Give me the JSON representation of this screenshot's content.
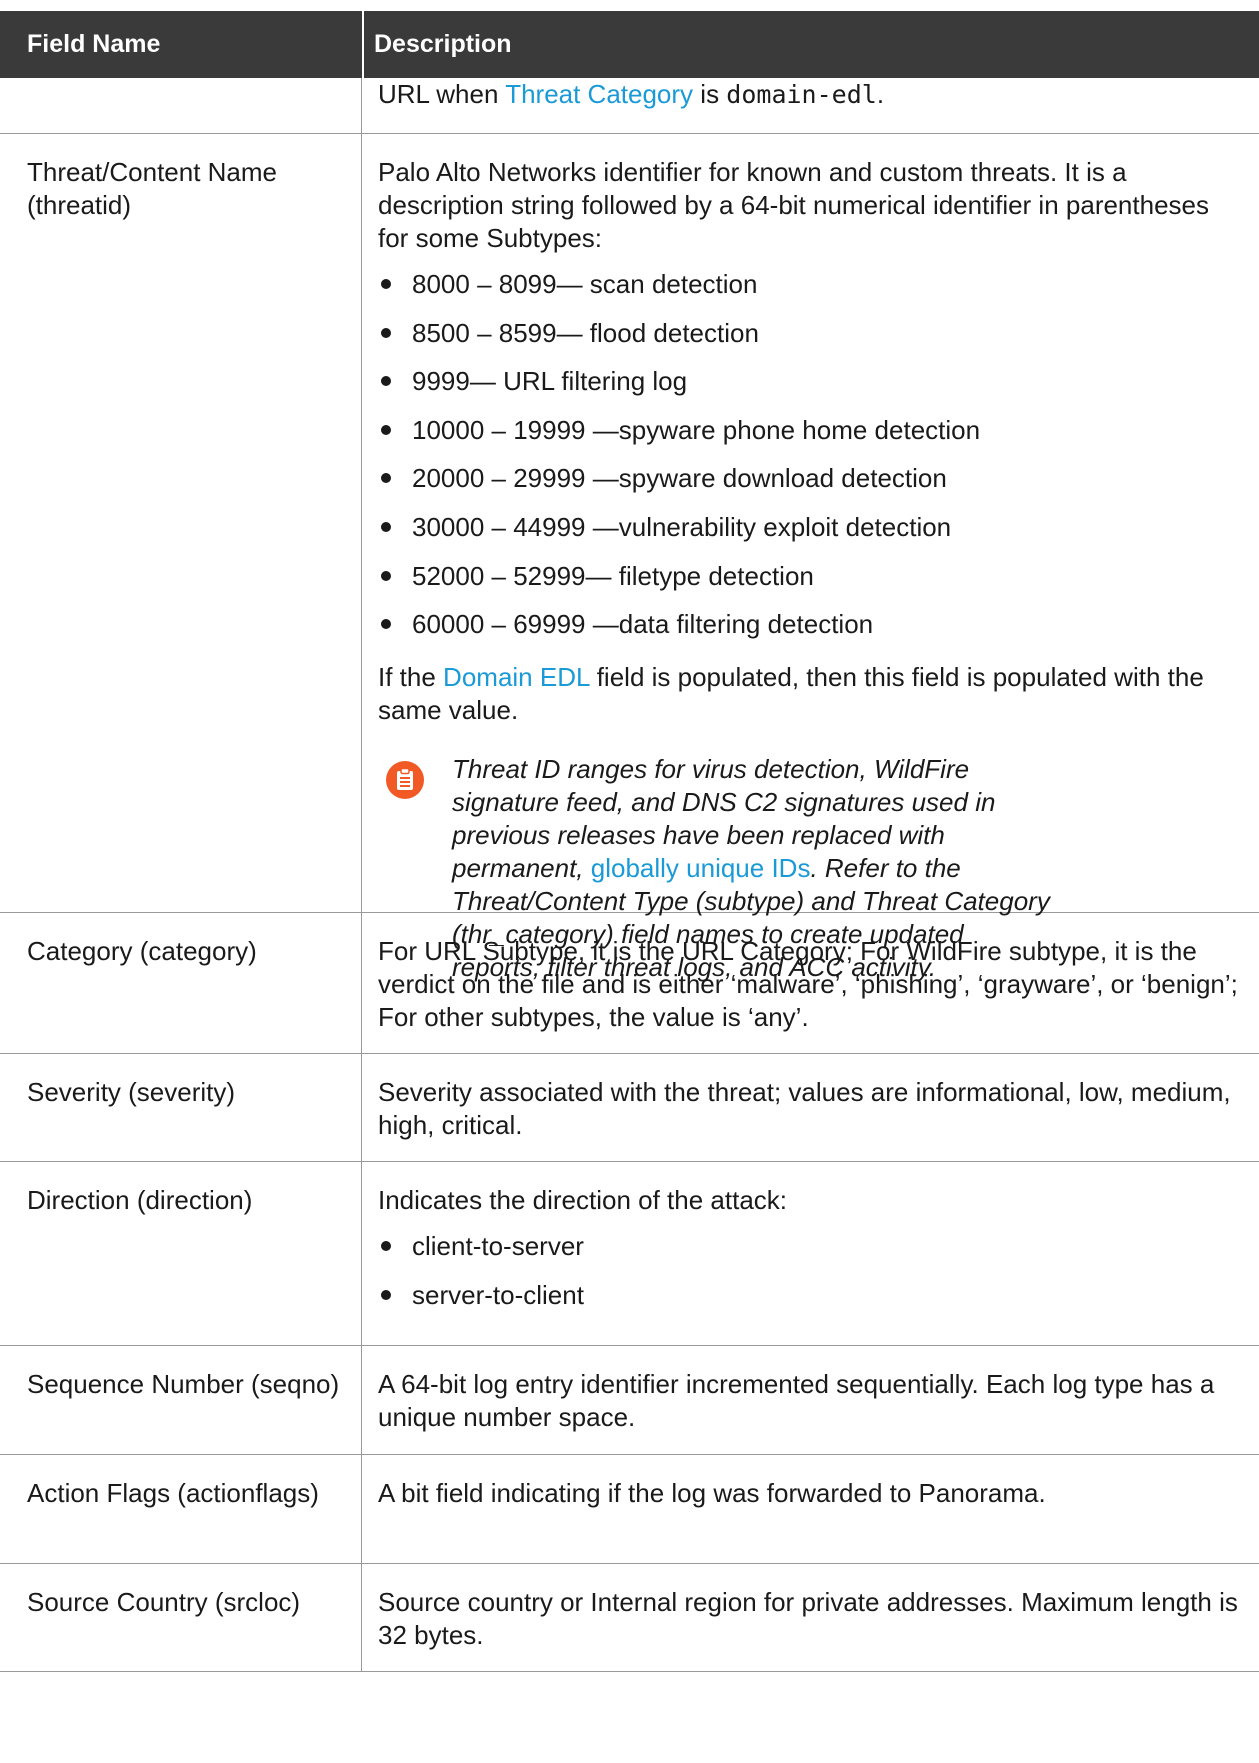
{
  "header": {
    "col_name": "Field Name",
    "col_desc": "Description"
  },
  "row0": {
    "text_a": "URL when ",
    "link": "Threat Category",
    "text_b": " is ",
    "mono": "domain-edl",
    "text_c": "."
  },
  "row1": {
    "name": "Threat/Content Name (threatid)",
    "intro": "Palo Alto Networks identifier for known and custom threats. It is a description string followed by a 64-bit numerical identifier in parentheses for some Subtypes:",
    "bullets": [
      "8000 – 8099— scan detection",
      "8500 – 8599— flood detection",
      "9999— URL filtering log",
      "10000 – 19999 —spyware phone home detection",
      "20000 – 29999 —spyware download detection",
      "30000 – 44999 —vulnerability exploit detection",
      "52000 – 52999— filetype detection",
      "60000 – 69999 —data filtering detection"
    ],
    "edl_a": "If the ",
    "edl_link": "Domain EDL",
    "edl_b": " field is populated, then this field is populated with the same value.",
    "note_icon": "note-clipboard-icon",
    "note_a": "Threat ID ranges for virus detection, WildFire signature feed, and DNS C2 signatures used in previous releases have been replaced with permanent, ",
    "note_link": "globally unique IDs",
    "note_b": ". Refer to the Threat/Content Type (subtype) and Threat Category (thr_category) field names to create updated reports, filter threat logs, and ACC activity."
  },
  "row2": {
    "name": "Category (category)",
    "desc": "For URL Subtype, it is the URL Category; For WildFire subtype, it is the verdict on the file and is either ‘malware’, ‘phishing’, ‘grayware’, or ‘benign’; For other subtypes, the value is ‘any’."
  },
  "row3": {
    "name": "Severity (severity)",
    "desc": "Severity associated with the threat; values are informational, low, medium, high, critical."
  },
  "row4": {
    "name": "Direction (direction)",
    "desc": "Indicates the direction of the attack:",
    "bullets": [
      "client-to-server",
      "server-to-client"
    ]
  },
  "row5": {
    "name": "Sequence Number (seqno)",
    "desc": "A 64-bit log entry identifier incremented sequentially. Each log type has a unique number space."
  },
  "row6": {
    "name": "Action Flags (actionflags)",
    "desc": "A bit field indicating if the log was forwarded to Panorama."
  },
  "row7": {
    "name": "Source Country (srcloc)",
    "desc": "Source country or Internal region for private addresses. Maximum length is 32 bytes."
  },
  "colors": {
    "header_bg": "#3a3a3a",
    "link": "#1a9ad6",
    "note_icon": "#f15a24"
  }
}
